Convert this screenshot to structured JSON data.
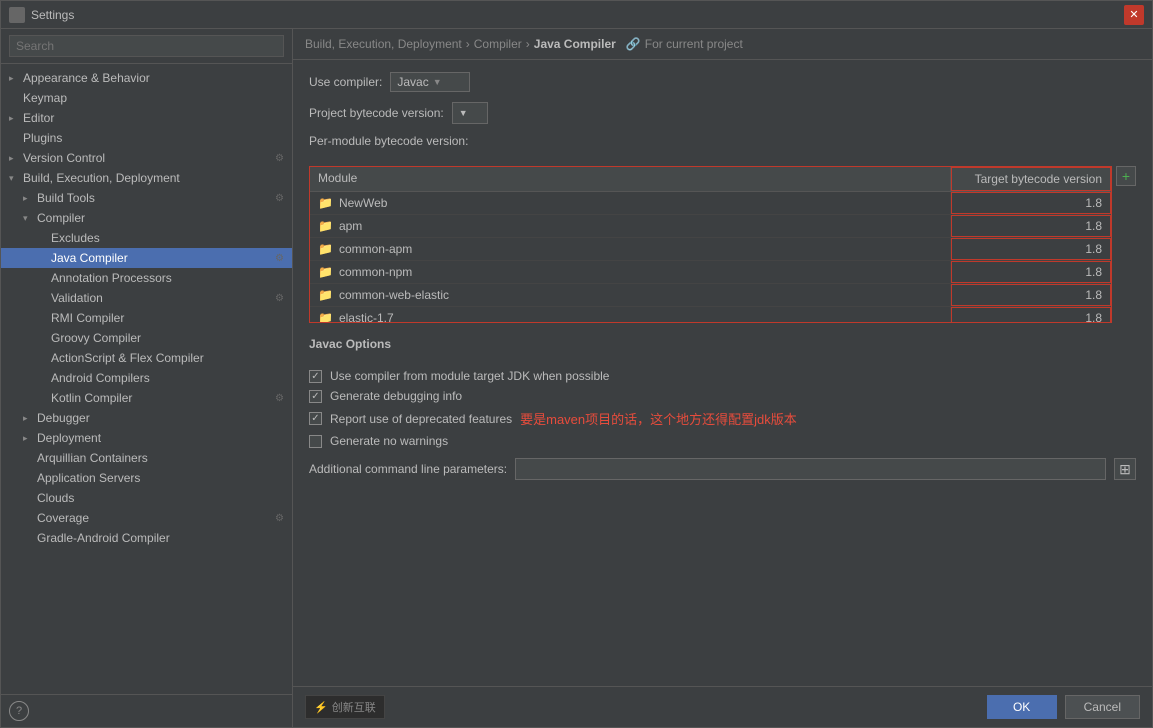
{
  "window": {
    "title": "Settings"
  },
  "sidebar": {
    "search_placeholder": "Search",
    "items": [
      {
        "id": "appearance",
        "label": "Appearance & Behavior",
        "indent": 1,
        "expandable": true,
        "expanded": false,
        "settings_icon": false
      },
      {
        "id": "keymap",
        "label": "Keymap",
        "indent": 1,
        "expandable": false,
        "settings_icon": false
      },
      {
        "id": "editor",
        "label": "Editor",
        "indent": 1,
        "expandable": true,
        "settings_icon": false
      },
      {
        "id": "plugins",
        "label": "Plugins",
        "indent": 1,
        "expandable": false,
        "settings_icon": false
      },
      {
        "id": "version-control",
        "label": "Version Control",
        "indent": 1,
        "expandable": true,
        "settings_icon": true
      },
      {
        "id": "build-execution",
        "label": "Build, Execution, Deployment",
        "indent": 1,
        "expandable": true,
        "expanded": true,
        "settings_icon": false
      },
      {
        "id": "build-tools",
        "label": "Build Tools",
        "indent": 2,
        "expandable": true,
        "settings_icon": true
      },
      {
        "id": "compiler",
        "label": "Compiler",
        "indent": 2,
        "expandable": true,
        "expanded": true,
        "settings_icon": false
      },
      {
        "id": "excludes",
        "label": "Excludes",
        "indent": 3,
        "expandable": false,
        "settings_icon": false
      },
      {
        "id": "java-compiler",
        "label": "Java Compiler",
        "indent": 3,
        "expandable": false,
        "settings_icon": true,
        "selected": true
      },
      {
        "id": "annotation-processors",
        "label": "Annotation Processors",
        "indent": 3,
        "expandable": false,
        "settings_icon": false
      },
      {
        "id": "validation",
        "label": "Validation",
        "indent": 3,
        "expandable": false,
        "settings_icon": true
      },
      {
        "id": "rmi-compiler",
        "label": "RMI Compiler",
        "indent": 3,
        "expandable": false,
        "settings_icon": false
      },
      {
        "id": "groovy-compiler",
        "label": "Groovy Compiler",
        "indent": 3,
        "expandable": false,
        "settings_icon": false
      },
      {
        "id": "actionscript-flex",
        "label": "ActionScript & Flex Compiler",
        "indent": 3,
        "expandable": false,
        "settings_icon": false
      },
      {
        "id": "android-compilers",
        "label": "Android Compilers",
        "indent": 3,
        "expandable": false,
        "settings_icon": false
      },
      {
        "id": "kotlin-compiler",
        "label": "Kotlin Compiler",
        "indent": 3,
        "expandable": false,
        "settings_icon": true
      },
      {
        "id": "debugger",
        "label": "Debugger",
        "indent": 2,
        "expandable": true,
        "settings_icon": false
      },
      {
        "id": "deployment",
        "label": "Deployment",
        "indent": 2,
        "expandable": true,
        "settings_icon": false
      },
      {
        "id": "arquillian-containers",
        "label": "Arquillian Containers",
        "indent": 2,
        "expandable": false,
        "settings_icon": false
      },
      {
        "id": "application-servers",
        "label": "Application Servers",
        "indent": 2,
        "expandable": false,
        "settings_icon": false
      },
      {
        "id": "clouds",
        "label": "Clouds",
        "indent": 2,
        "expandable": false,
        "settings_icon": false
      },
      {
        "id": "coverage",
        "label": "Coverage",
        "indent": 2,
        "expandable": false,
        "settings_icon": true
      },
      {
        "id": "gradle-android",
        "label": "Gradle-Android Compiler",
        "indent": 2,
        "expandable": false,
        "settings_icon": false
      }
    ]
  },
  "breadcrumb": {
    "parts": [
      "Build, Execution, Deployment",
      "Compiler",
      "Java Compiler"
    ],
    "separator": "›",
    "for_project": "For current project",
    "icon": "🔗"
  },
  "main": {
    "use_compiler_label": "Use compiler:",
    "use_compiler_value": "Javac",
    "project_bytecode_label": "Project bytecode version:",
    "project_bytecode_value": "",
    "per_module_label": "Per-module bytecode version:",
    "table": {
      "col_module": "Module",
      "col_target": "Target bytecode version",
      "rows": [
        {
          "name": "NewWeb",
          "version": "1.8"
        },
        {
          "name": "apm",
          "version": "1.8"
        },
        {
          "name": "common-apm",
          "version": "1.8"
        },
        {
          "name": "common-npm",
          "version": "1.8"
        },
        {
          "name": "common-web-elastic",
          "version": "1.8"
        },
        {
          "name": "elastic-1.7",
          "version": "1.8"
        }
      ]
    },
    "javac_options_label": "Javac Options",
    "checkboxes": [
      {
        "id": "use-module-target",
        "label": "Use compiler from module target JDK when possible",
        "checked": true
      },
      {
        "id": "generate-debug",
        "label": "Generate debugging info",
        "checked": true
      },
      {
        "id": "report-deprecated",
        "label": "Report use of deprecated features",
        "checked": true
      },
      {
        "id": "no-warnings",
        "label": "Generate no warnings",
        "checked": false
      }
    ],
    "annotation_text": "要是maven项目的话，这个地方还得配置jdk版本",
    "cmdline_label": "Additional command line parameters:",
    "cmdline_value": "",
    "cmdline_btn": "⊞"
  },
  "buttons": {
    "ok": "OK",
    "cancel": "Cancel"
  },
  "watermark": {
    "text": "创新互联"
  }
}
